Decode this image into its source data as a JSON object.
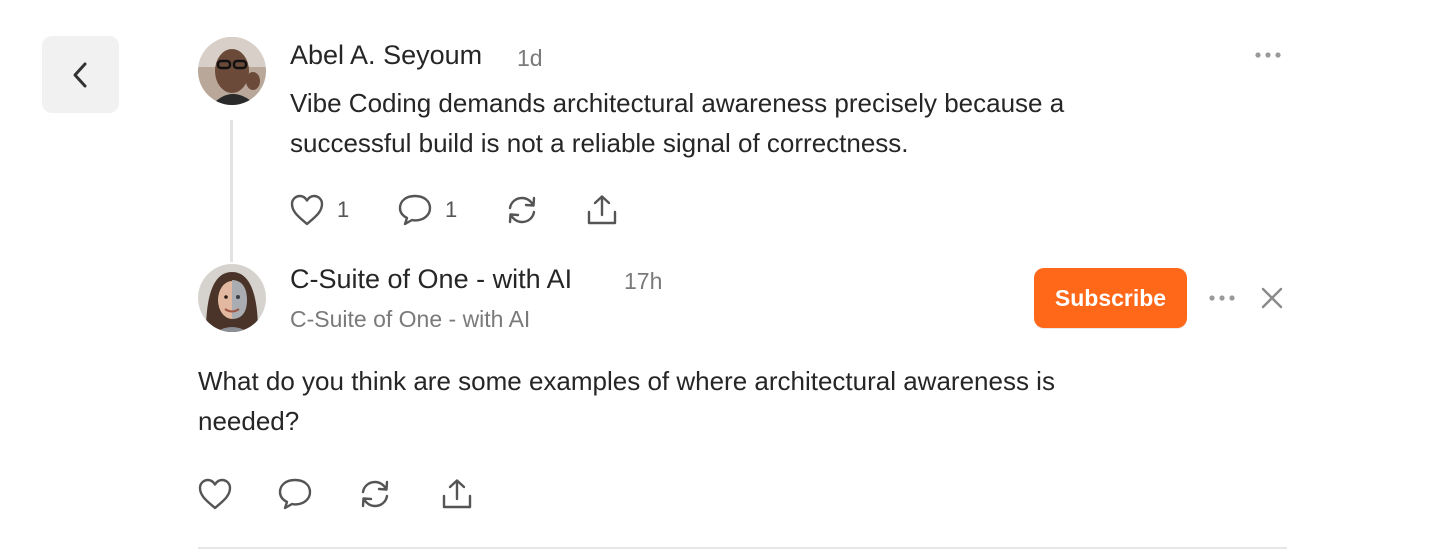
{
  "back_button": {
    "icon": "chevron-left-icon"
  },
  "post": {
    "author": "Abel A. Seyoum",
    "time": "1d",
    "text_line1": "Vibe Coding demands architectural awareness precisely because a",
    "text_line2": "successful build is not a reliable signal of correctness.",
    "likes": "1",
    "comments": "1"
  },
  "reply": {
    "author": "C-Suite of One - with AI",
    "time": "17h",
    "publication": "C-Suite of One - with AI",
    "subscribe_label": "Subscribe",
    "text_line1": "What do you think are some examples of where architectural awareness is",
    "text_line2": "needed?"
  },
  "colors": {
    "subscribe": "#ff6719",
    "icon": "#555555",
    "back_bg": "#f1f1f1"
  }
}
